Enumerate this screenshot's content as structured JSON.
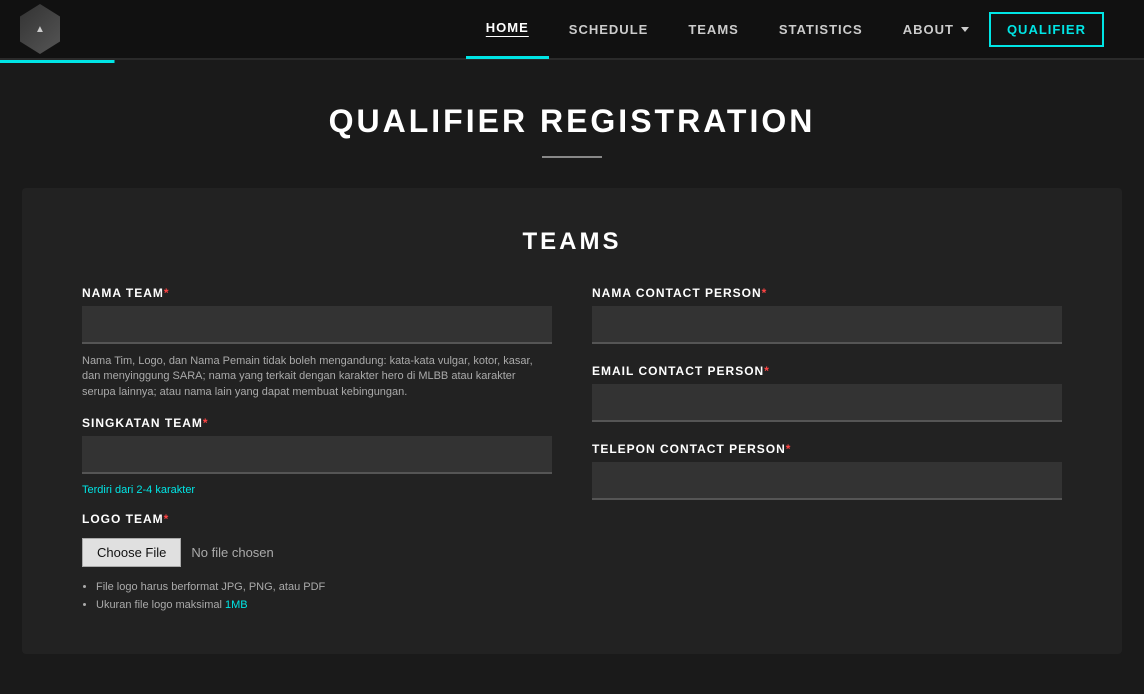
{
  "nav": {
    "links": [
      {
        "label": "HOME",
        "active": true
      },
      {
        "label": "SCHEDULE",
        "active": false
      },
      {
        "label": "TEAMS",
        "active": false
      },
      {
        "label": "STATISTICS",
        "active": false
      },
      {
        "label": "ABOUT",
        "active": false,
        "hasDropdown": true
      }
    ],
    "qualifier_btn": "QUALIFIER"
  },
  "page": {
    "title": "QUALIFIER REGISTRATION"
  },
  "form": {
    "section_title": "TEAMS",
    "fields": {
      "nama_team": {
        "label": "NAMA TEAM",
        "required": true,
        "note": "Nama Tim, Logo, dan Nama Pemain tidak boleh mengandung: kata-kata vulgar, kotor, kasar, dan menyinggung SARA; nama yang terkait dengan karakter hero di MLBB atau karakter serupa lainnya; atau nama lain yang dapat membuat kebingungan."
      },
      "singkatan_team": {
        "label": "SINGKATAN TEAM",
        "required": true,
        "hint": "Terdiri dari 2-4 karakter"
      },
      "logo_team": {
        "label": "LOGO TEAM",
        "required": true,
        "choose_file_btn": "Choose File",
        "no_file_text": "No file chosen",
        "rules": [
          "File logo harus berformat JPG, PNG, atau PDF",
          "Ukuran file logo maksimal 1MB"
        ]
      },
      "nama_contact_person": {
        "label": "NAMA CONTACT PERSON",
        "required": true
      },
      "email_contact_person": {
        "label": "EMAIL CONTACT PERSON",
        "required": true
      },
      "telepon_contact_person": {
        "label": "TELEPON CONTACT PERSON",
        "required": true
      }
    }
  }
}
